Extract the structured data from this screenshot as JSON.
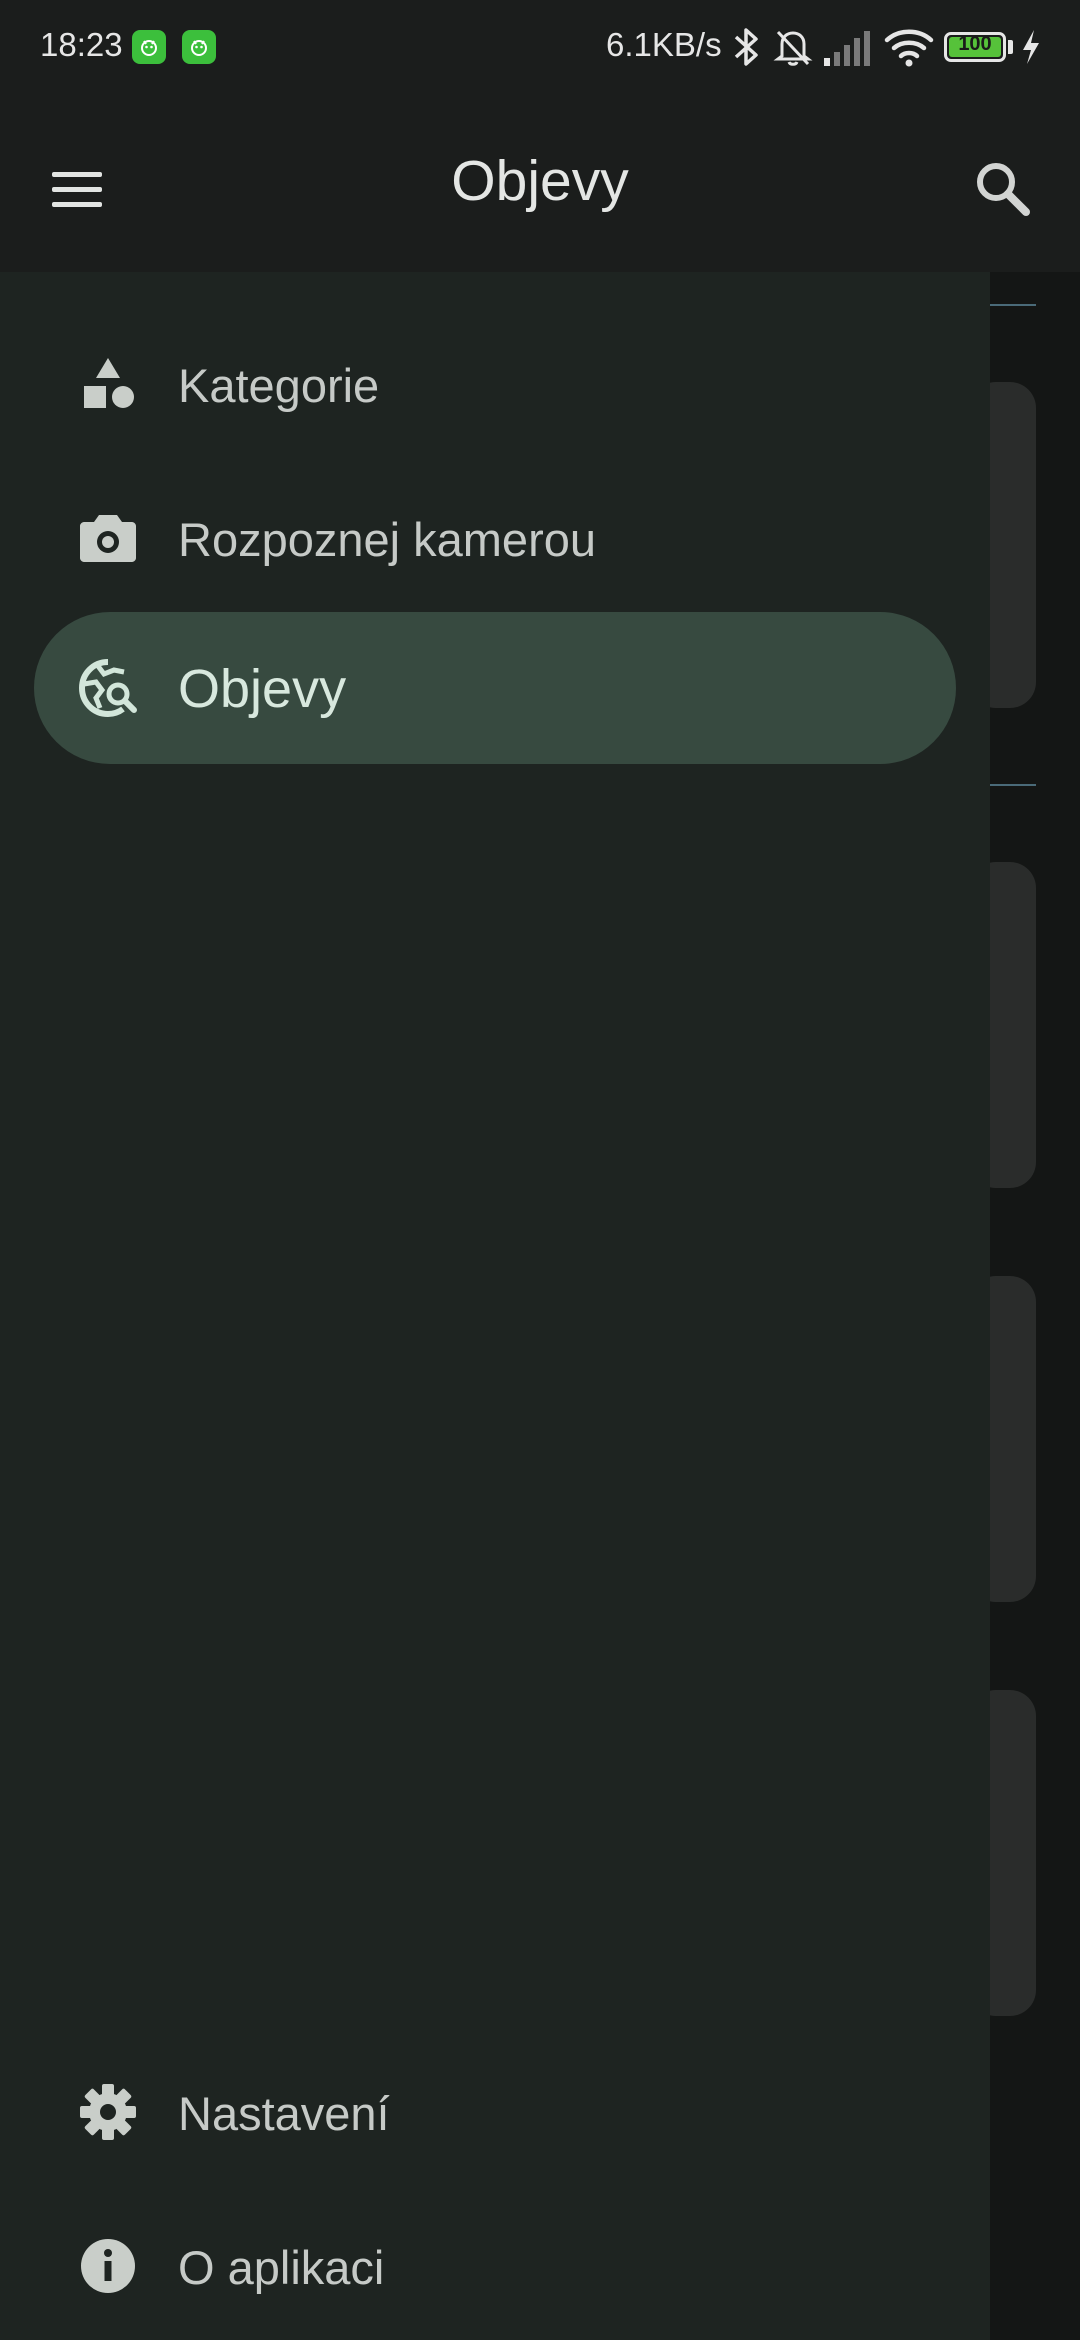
{
  "status_bar": {
    "time": "18:23",
    "net_speed": "6.1KB/s",
    "battery": "100"
  },
  "app_bar": {
    "title": "Objevy"
  },
  "drawer": {
    "items": [
      {
        "label": "Kategorie",
        "icon": "shapes-icon",
        "active": false
      },
      {
        "label": "Rozpoznej kamerou",
        "icon": "camera-icon",
        "active": false
      },
      {
        "label": "Objevy",
        "icon": "travel-explore-icon",
        "active": true
      }
    ],
    "footer_items": [
      {
        "label": "Nastavení",
        "icon": "gear-icon"
      },
      {
        "label": "O aplikaci",
        "icon": "info-icon"
      }
    ]
  },
  "colors": {
    "app_bar_bg": "#1b1d1c",
    "drawer_bg": "#1e2421",
    "active_item_bg": "#374a40",
    "text": "#c6cac7",
    "icon": "#c9cec9"
  }
}
